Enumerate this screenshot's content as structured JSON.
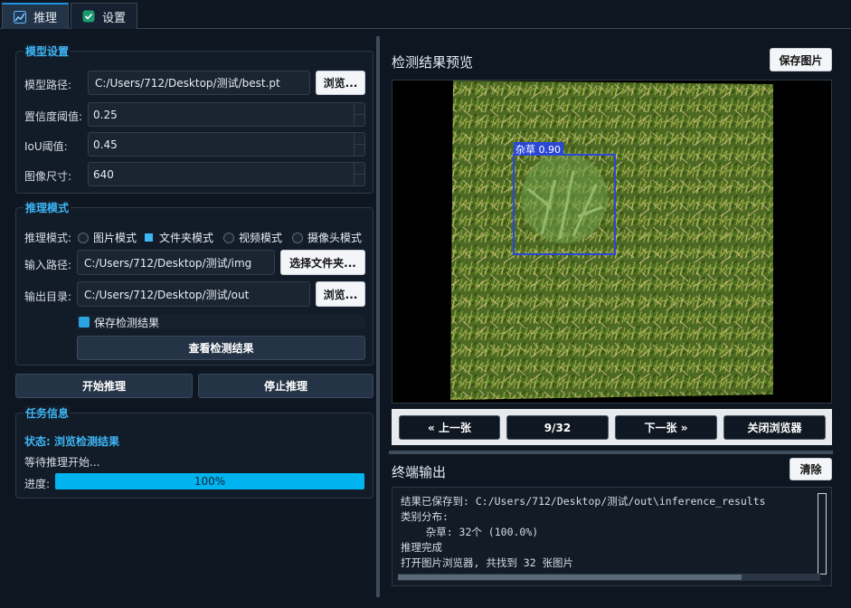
{
  "tabs": [
    {
      "label": "推理",
      "icon": "chart-icon"
    },
    {
      "label": "设置",
      "icon": "check-icon"
    }
  ],
  "model_settings": {
    "title": "模型设置",
    "model_path_label": "模型路径:",
    "model_path_value": "C:/Users/712/Desktop/测试/best.pt",
    "browse_label": "浏览...",
    "conf_label": "置信度阈值:",
    "conf_value": "0.25",
    "iou_label": "IoU阈值:",
    "iou_value": "0.45",
    "imgsz_label": "图像尺寸:",
    "imgsz_value": "640"
  },
  "inference_mode": {
    "title": "推理模式",
    "mode_label": "推理模式:",
    "modes": [
      "图片模式",
      "文件夹模式",
      "视频模式",
      "摄像头模式"
    ],
    "selected_mode": "文件夹模式",
    "input_label": "输入路径:",
    "input_value": "C:/Users/712/Desktop/测试/img",
    "select_folder_label": "选择文件夹...",
    "output_label": "输出目录:",
    "output_value": "C:/Users/712/Desktop/测试/out",
    "output_browse_label": "浏览...",
    "save_results_label": "保存检测结果",
    "save_results_checked": true,
    "view_results_label": "查看检测结果"
  },
  "actions": {
    "start_label": "开始推理",
    "stop_label": "停止推理"
  },
  "task_info": {
    "title": "任务信息",
    "status": "状态: 浏览检测结果",
    "message": "等待推理开始...",
    "progress_label": "进度:",
    "progress_text": "100%",
    "progress_value": 1.0
  },
  "preview": {
    "title": "检测结果预览",
    "save_image_label": "保存图片",
    "detection_label": "杂草 0.90",
    "box_color": "#2a47d6"
  },
  "navigation": {
    "prev_label": "« 上一张",
    "counter": "9/32",
    "next_label": "下一张 »",
    "close_label": "关闭浏览器"
  },
  "terminal": {
    "title": "终端输出",
    "clear_label": "清除",
    "lines": [
      "结果已保存到: C:/Users/712/Desktop/测试/out\\inference_results",
      "类别分布:",
      "    杂草: 32个 (100.0%)",
      "推理完成",
      "打开图片浏览器, 共找到 32 张图片"
    ]
  },
  "colors": {
    "accent": "#3db6f5",
    "progress": "#00b4f0",
    "background": "#0e1621"
  }
}
